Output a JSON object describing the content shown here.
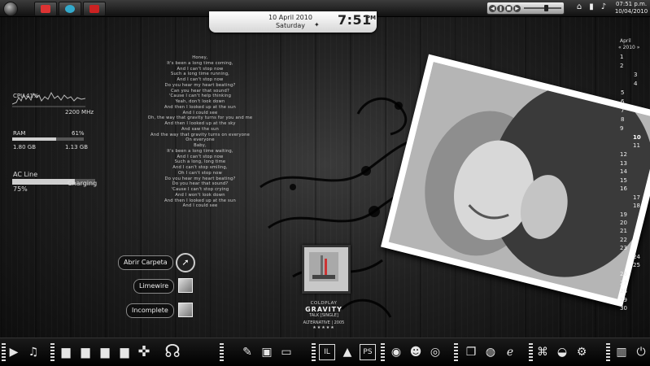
{
  "top_clock": {
    "date": "10 April 2010",
    "weekday": "Saturday",
    "time": "7:51",
    "ampm": "PM"
  },
  "tray": {
    "time": "07:51 p.m.",
    "date": "10/04/2010"
  },
  "meters": {
    "cpu_label": "CPU",
    "cpu_percent": "41%",
    "cpu_freq": "2200 MHz",
    "ram_label": "RAM",
    "ram_percent": "61%",
    "ram_used": "1.80 GB",
    "ram_total": "1.13 GB",
    "ram_fill": 0.61,
    "power_label": "AC Line",
    "power_status": "Charging",
    "power_percent": "75%",
    "power_fill": 0.75
  },
  "lyrics": [
    "Honey,",
    "It's been a long time coming,",
    "And I can't stop now",
    "Such a long time running,",
    "And I can't stop now",
    "Do you hear my heart beating?",
    "Can you hear that sound?",
    "'Cause I can't help thinking",
    "Yeah, don't look down",
    "And then I looked up at the sun",
    "And I could see",
    "Oh, the way that gravity turns for you and me",
    "And then I looked up at the sky",
    "And saw the sun",
    "And the way that gravity turns on everyone",
    "On everyone",
    "Baby,",
    "It's been a long time waiting,",
    "And I can't stop now",
    "Such a long, long time",
    "And I can't stop smiling,",
    "Oh I can't stop now",
    "Do you hear my heart beating?",
    "Do you hear that sound?",
    "'Cause I can't stop crying",
    "And I won't look down",
    "And then I looked up at the sun",
    "And I could see"
  ],
  "calendar": {
    "month": "April",
    "year": "2010",
    "days": [
      "1",
      "2",
      "3",
      "4",
      "5",
      "6",
      "7",
      "8",
      "9",
      "10",
      "11",
      "12",
      "13",
      "14",
      "15",
      "16",
      "17",
      "18",
      "19",
      "20",
      "21",
      "22",
      "23",
      "24",
      "25",
      "26",
      "27",
      "28",
      "29",
      "30"
    ],
    "today": "10"
  },
  "shortcuts": [
    {
      "label": "Abrir Carpeta"
    },
    {
      "label": "Limewire"
    },
    {
      "label": "Incomplete"
    }
  ],
  "album": {
    "artist": "COLDPLAY",
    "title": "GRAVITY",
    "subtitle": "TALK [SINGLE]",
    "genre_year": "ALTERNATIVE | 2005",
    "stars": "★★★★★"
  },
  "colors": {
    "accent": "#ffffff",
    "background": "#141414",
    "meter_fill": "#cfcfcf"
  }
}
